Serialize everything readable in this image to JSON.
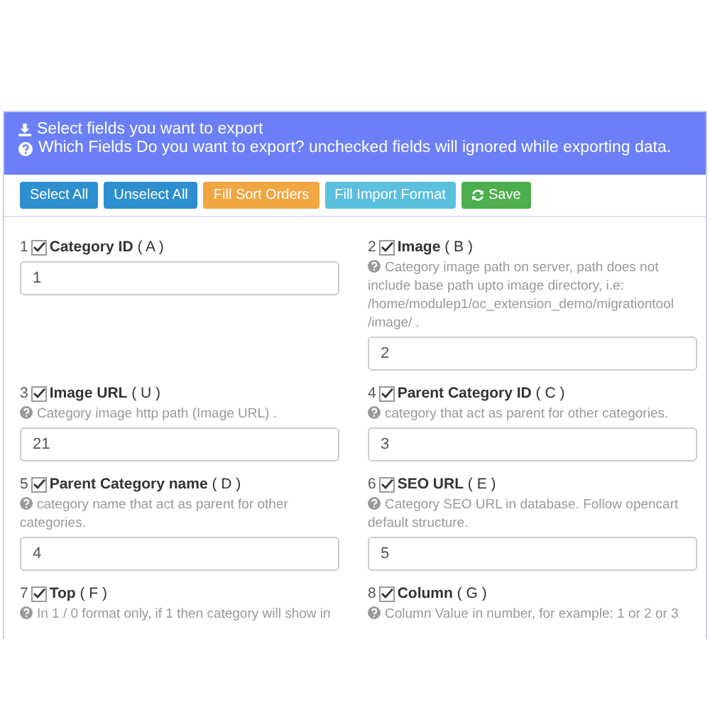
{
  "header": {
    "title": "Select fields you want to export",
    "subtitle": "Which Fields Do you want to export? unchecked fields will ignored while exporting data."
  },
  "toolbar": [
    {
      "label": "Select All",
      "kind": "primary"
    },
    {
      "label": "Unselect All",
      "kind": "primary"
    },
    {
      "label": "Fill Sort Orders",
      "kind": "warning"
    },
    {
      "label": "Fill Import Format",
      "kind": "info"
    },
    {
      "label": "Save",
      "kind": "success"
    }
  ],
  "fields": [
    {
      "number": "1",
      "checked": true,
      "label": "**Category ID** ( A )",
      "value": "1"
    },
    {
      "number": "2",
      "checked": true,
      "label": "**Image** ( B )",
      "hint": "Category image path on server, path does not include base path upto image directory, i.e: /home/modulep1/oc_extension_demo/migrationtool /image/ .",
      "value": "2"
    },
    {
      "number": "3",
      "checked": true,
      "label": "**Image URL** ( U )",
      "hint": "Category image http path (Image URL) .",
      "value": "21"
    },
    {
      "number": "4",
      "checked": true,
      "label": "**Parent Category ID** ( C )",
      "hint": "category that act as parent for other categories.",
      "value": "3"
    },
    {
      "number": "5",
      "checked": true,
      "label": "**Parent Category name** ( D )",
      "hint": "category name that act as parent for other categories.",
      "value": "4"
    },
    {
      "number": "6",
      "checked": true,
      "label": "**SEO URL** ( E )",
      "hint": "Category SEO URL in database. Follow opencart default structure.",
      "value": "5"
    },
    {
      "number": "7",
      "checked": true,
      "label": "**Top** ( F )",
      "hint": "In 1 / 0 format only, if 1 then category will show in"
    },
    {
      "number": "8",
      "checked": true,
      "label": "**Column** ( G )",
      "hint": "Column Value in number, for example: 1 or 2 or 3"
    }
  ]
}
